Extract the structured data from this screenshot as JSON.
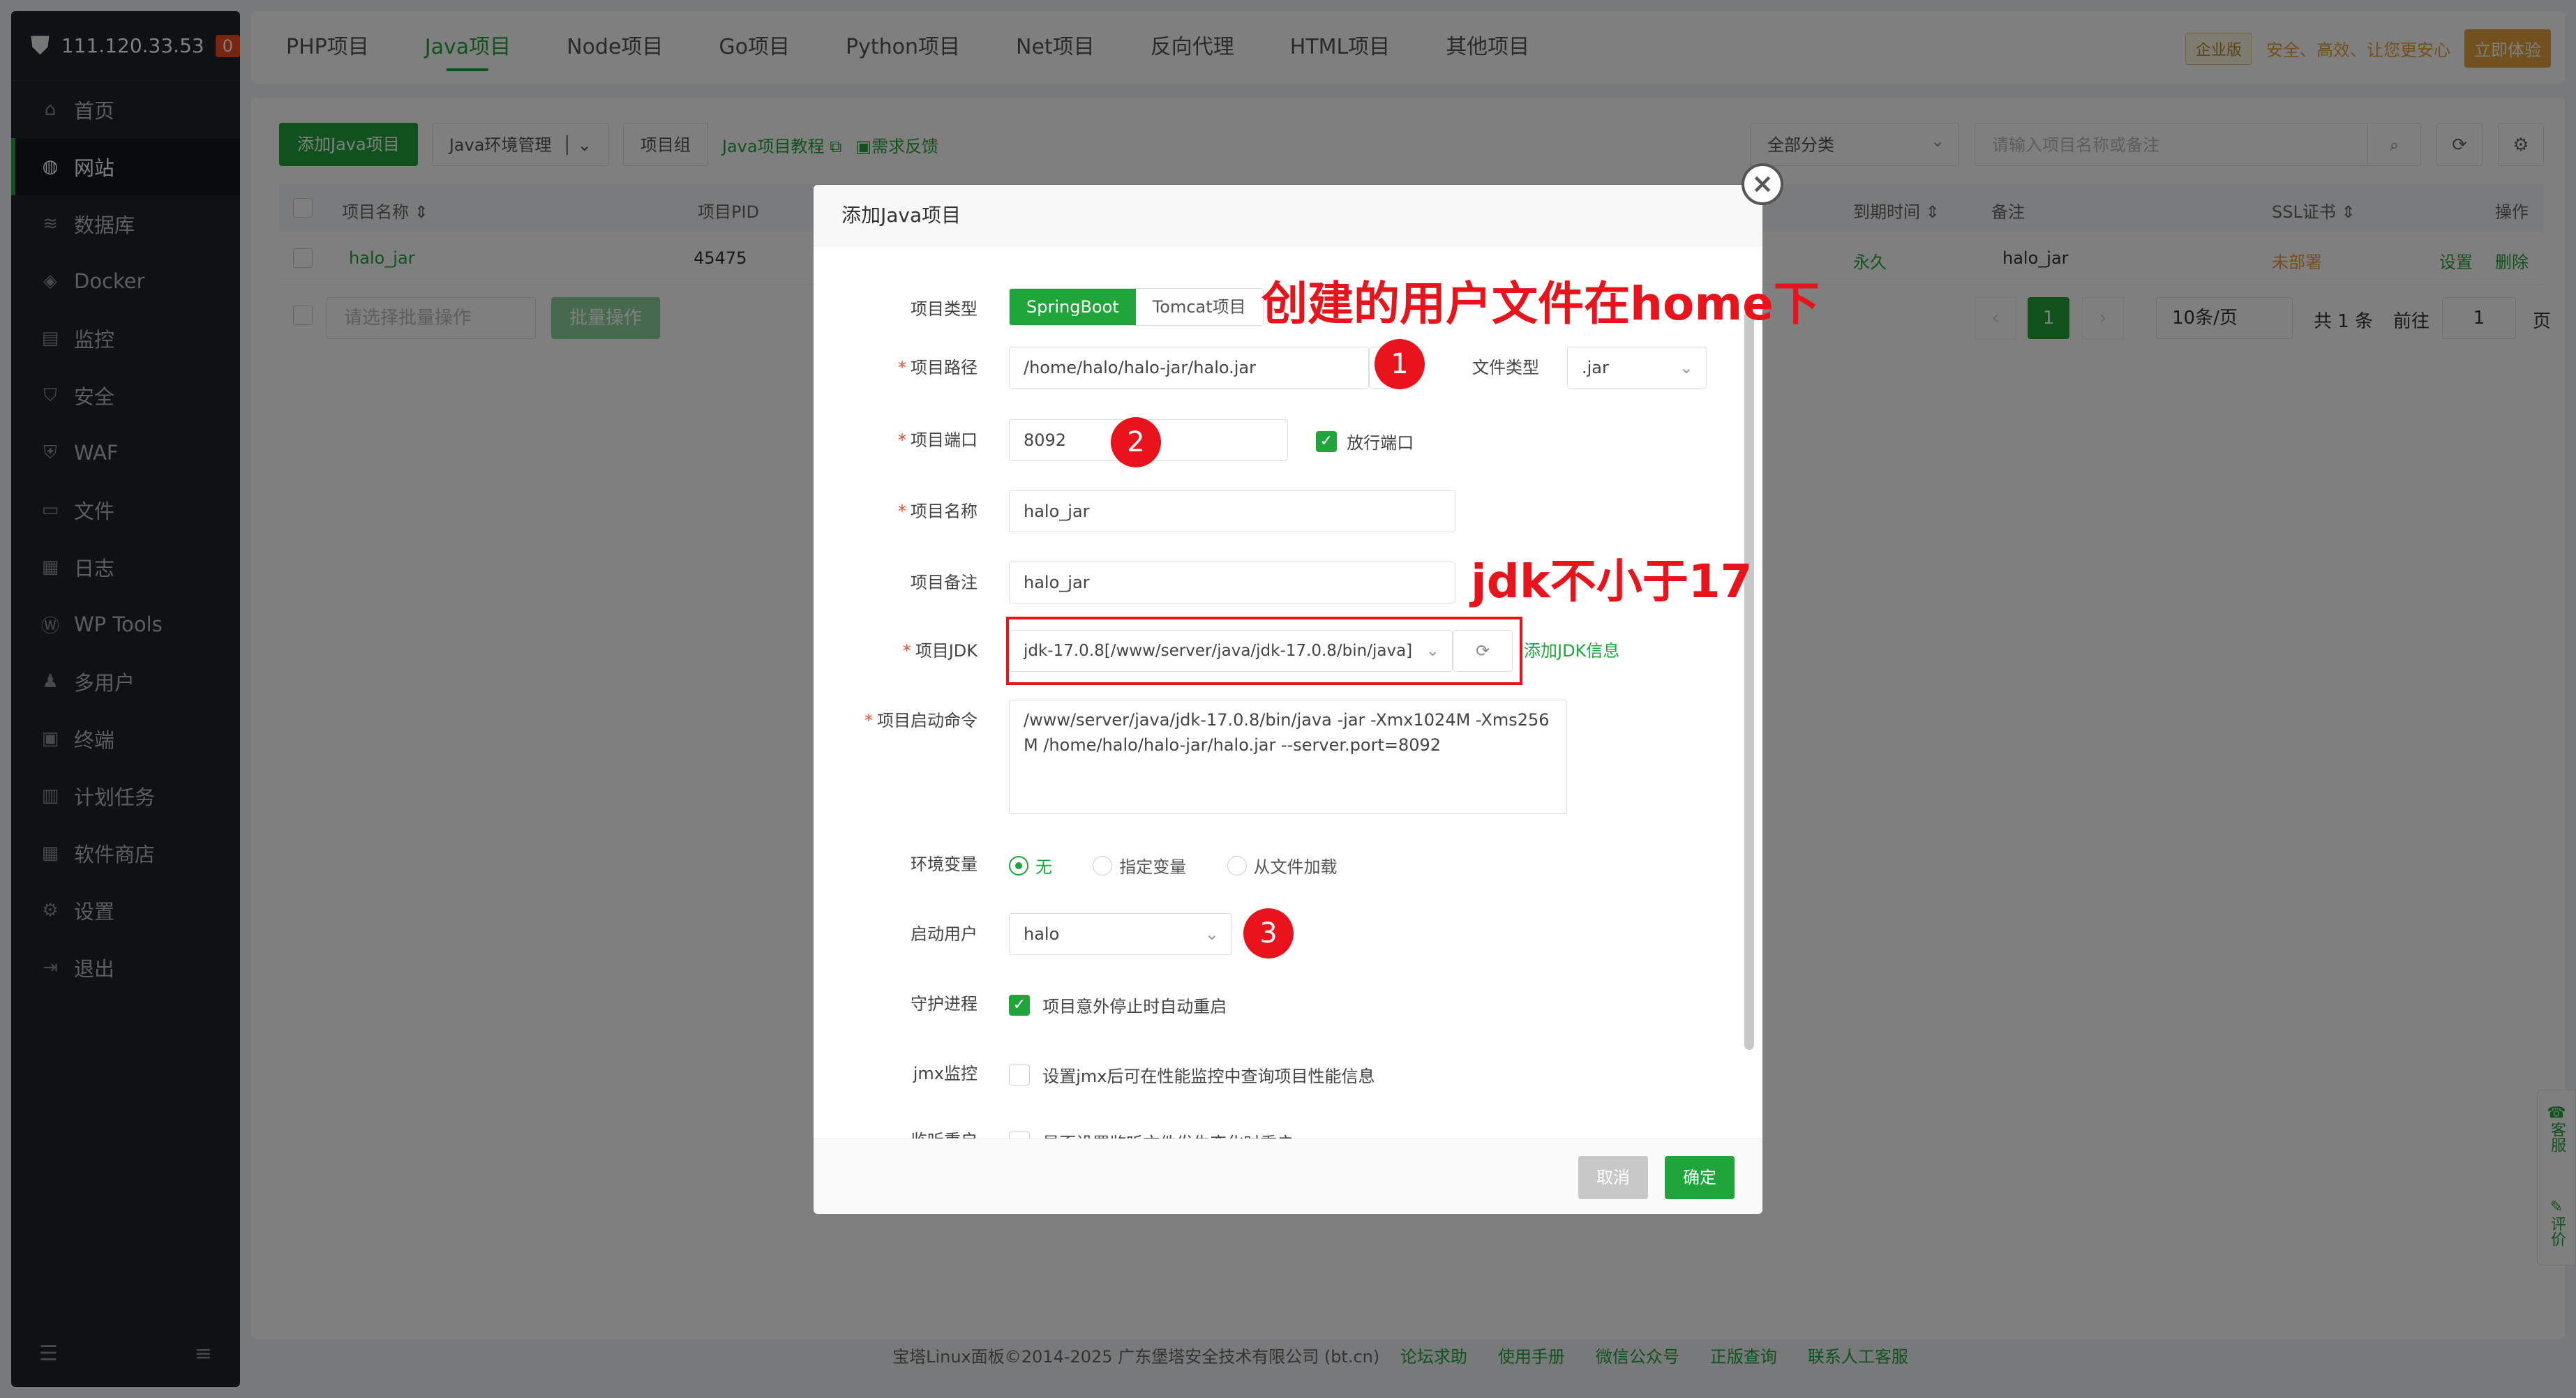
{
  "sidebar": {
    "server_ip": "111.120.33.53",
    "badge": "0",
    "items": [
      {
        "label": "首页",
        "icon": "home-icon"
      },
      {
        "label": "网站",
        "icon": "globe-icon",
        "active": true
      },
      {
        "label": "数据库",
        "icon": "database-icon"
      },
      {
        "label": "Docker",
        "icon": "docker-icon"
      },
      {
        "label": "监控",
        "icon": "monitor-icon"
      },
      {
        "label": "安全",
        "icon": "shield-icon"
      },
      {
        "label": "WAF",
        "icon": "waf-icon"
      },
      {
        "label": "文件",
        "icon": "folder-icon"
      },
      {
        "label": "日志",
        "icon": "log-icon"
      },
      {
        "label": "WP Tools",
        "icon": "wordpress-icon"
      },
      {
        "label": "多用户",
        "icon": "users-icon"
      },
      {
        "label": "终端",
        "icon": "terminal-icon"
      },
      {
        "label": "计划任务",
        "icon": "calendar-icon"
      },
      {
        "label": "软件商店",
        "icon": "grid-icon"
      },
      {
        "label": "设置",
        "icon": "gear-icon"
      },
      {
        "label": "退出",
        "icon": "logout-icon"
      }
    ]
  },
  "tabs": [
    "PHP项目",
    "Java项目",
    "Node项目",
    "Go项目",
    "Python项目",
    "Net项目",
    "反向代理",
    "HTML项目",
    "其他项目"
  ],
  "top_right": {
    "edition": "企业版",
    "slogan": "安全、高效、让您更安心",
    "try_label": "立即体验"
  },
  "toolbar": {
    "add_label": "添加Java项目",
    "env_label": "Java环境管理",
    "group_label": "项目组",
    "tutorial_label": "Java项目教程",
    "feedback_label": "需求反馈",
    "category": "全部分类",
    "search_placeholder": "请输入项目名称或备注"
  },
  "table": {
    "headers": {
      "name": "项目名称",
      "pid": "项目PID",
      "expire": "到期时间",
      "remark": "备注",
      "ssl": "SSL证书",
      "ops": "操作"
    },
    "row": {
      "name": "halo_jar",
      "pid": "45475",
      "expire": "永久",
      "remark": "halo_jar",
      "ssl": "未部署",
      "set": "设置",
      "del": "删除"
    },
    "batch_placeholder": "请选择批量操作",
    "batch_label": "批量操作",
    "page": "1",
    "per_page": "10条/页",
    "total": "共 1 条",
    "goto": "前往",
    "goto_page": "1",
    "page_unit": "页"
  },
  "modal": {
    "title": "添加Java项目",
    "type_label": "项目类型",
    "type_springboot": "SpringBoot",
    "type_tomcat": "Tomcat项目",
    "path_label": "项目路径",
    "path_value": "/home/halo/halo-jar/halo.jar",
    "file_type_label": "文件类型",
    "file_type_value": ".jar",
    "port_label": "项目端口",
    "port_value": "8092",
    "open_port": "放行端口",
    "name_label": "项目名称",
    "name_value": "halo_jar",
    "remark_label": "项目备注",
    "remark_value": "halo_jar",
    "jdk_label": "项目JDK",
    "jdk_value": "jdk-17.0.8[/www/server/java/jdk-17.0.8/bin/java]",
    "add_jdk": "添加JDK信息",
    "cmd_label": "项目启动命令",
    "cmd_value": "/www/server/java/jdk-17.0.8/bin/java -jar  -Xmx1024M -Xms256M /home/halo/halo-jar/halo.jar --server.port=8092",
    "env_label": "环境变量",
    "env_none": "无",
    "env_specified": "指定变量",
    "env_file": "从文件加载",
    "user_label": "启动用户",
    "user_value": "halo",
    "daemon_label": "守护进程",
    "daemon_text": "项目意外停止时自动重启",
    "jmx_label": "jmx监控",
    "jmx_text": "设置jmx后可在性能监控中查询项目性能信息",
    "watch_label": "监听重启",
    "watch_text": "是否设置监听文件发生变化时重启",
    "cancel": "取消",
    "ok": "确定"
  },
  "annotations": {
    "n1": "1",
    "n2": "2",
    "n3": "3",
    "text_home": "创建的用户文件在home下",
    "text_jdk": "jdk不小于17"
  },
  "side_float": {
    "service": "客服",
    "review": "评价"
  },
  "footer": {
    "copyright": "宝塔Linux面板©2014-2025 广东堡塔安全技术有限公司 (bt.cn)",
    "links": [
      "论坛求助",
      "使用手册",
      "微信公众号",
      "正版查询",
      "联系人工客服"
    ]
  }
}
